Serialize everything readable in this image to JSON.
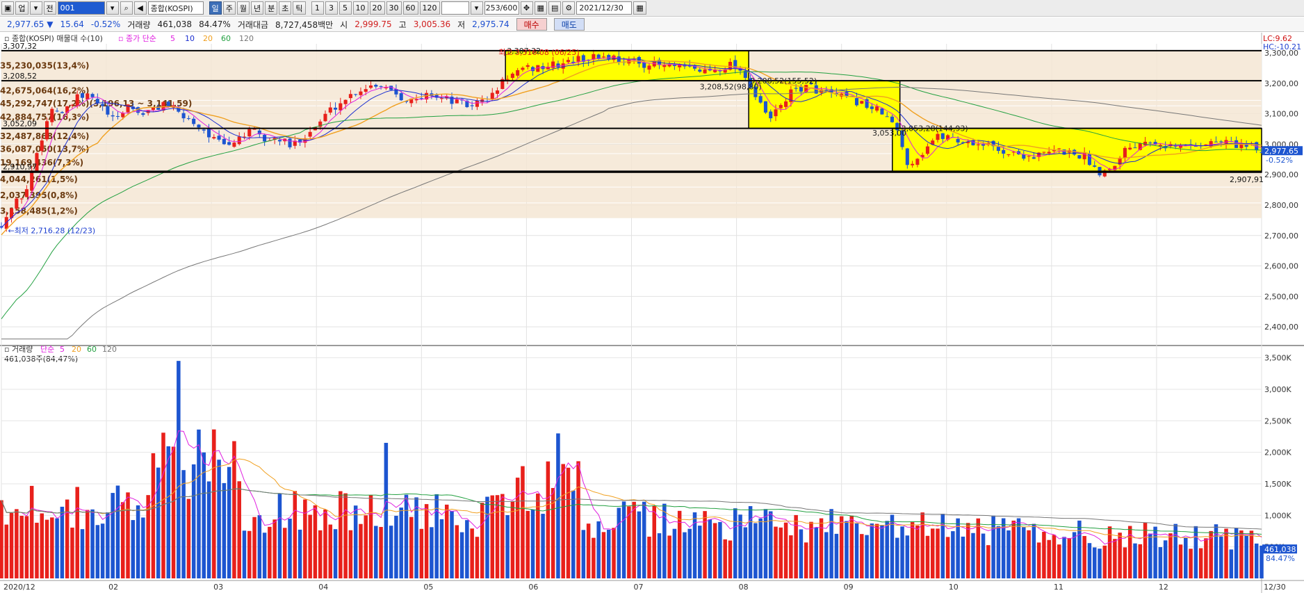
{
  "toolbar": {
    "market_label": "업",
    "type_label": "전",
    "code_value": "001",
    "name_value": "종합(KOSPI)",
    "period_tabs": [
      "일",
      "주",
      "월",
      "년",
      "분",
      "초",
      "틱"
    ],
    "active_period": "일",
    "intervals": [
      "1",
      "3",
      "5",
      "10",
      "20",
      "30",
      "60",
      "120"
    ],
    "count_value": "253/600",
    "date_value": "2021/12/30"
  },
  "quote": {
    "price": "2,977.65",
    "change_arrow": "▼",
    "change": "15.64",
    "change_pct": "-0.52%",
    "volume_label": "거래량",
    "volume": "461,038",
    "volume_ratio": "84.47%",
    "amount_label": "거래대금",
    "amount": "8,727,458백만",
    "open_label": "시",
    "open": "2,999.75",
    "high_label": "고",
    "high": "3,005.36",
    "low_label": "저",
    "low": "2,975.74",
    "buy_label": "매수",
    "sell_label": "매도"
  },
  "colors": {
    "up": "#e8201b",
    "down": "#1d55d0",
    "ma5": "#e020e0",
    "ma10": "#1c2fd0",
    "ma20": "#f0a020",
    "ma60": "#22a040",
    "ma120": "#777777",
    "box": "#ffff00",
    "band": "#f5e6d3"
  },
  "chart_data": [
    {
      "type": "candlestick",
      "title": "종합(KOSPI) 매물대 수(10)",
      "ma_legend_prefix": "종가 단순",
      "ma_periods": [
        "5",
        "10",
        "20",
        "60",
        "120"
      ],
      "corner_labels": {
        "lc": "LC:9.62",
        "hc": "HC:-10.21"
      },
      "ylim": [
        2350,
        3330
      ],
      "y_ticks": [
        "3,300,00",
        "3,200,00",
        "3,100,00",
        "3,000,00",
        "2,900,00",
        "2,800,00",
        "2,700,00",
        "2,600,00",
        "2,500,00",
        "2,400,00"
      ],
      "y_tick_values": [
        3300,
        3200,
        3100,
        3000,
        2900,
        2800,
        2700,
        2600,
        2500,
        2400
      ],
      "x_ticks": [
        "2020/12",
        "02",
        "03",
        "04",
        "05",
        "06",
        "07",
        "08",
        "09",
        "10",
        "11",
        "12",
        "12/30"
      ],
      "current_price_label": "2,977.65",
      "current_change_label": "-0.52%",
      "extremes": {
        "high": "최고 3,316.08 (06/25)",
        "low": "최저 2,716.28 (12/23)"
      },
      "horizontal_lines": [
        {
          "value": 3307.32,
          "label": "3,307,32"
        },
        {
          "value": 3208.52,
          "label": "3,208,52"
        },
        {
          "value": 3052.09,
          "label": "3,052,09"
        },
        {
          "value": 2910.97,
          "label": "2,910,97"
        },
        {
          "value": 2907.91,
          "label": "2,907,91"
        }
      ],
      "volume_profile": [
        {
          "range": [
            3208.52,
            3307.32
          ],
          "label": "35,230,035(13,4%)"
        },
        {
          "range": [
            3143,
            3208.52
          ],
          "label": "42,675,064(16,2%)"
        },
        {
          "range": [
            3125,
            3143
          ],
          "label": "45,292,747(17,2%)(3,196,13 ~ 3,141,59)"
        },
        {
          "range": [
            3052.09,
            3125
          ],
          "label": "42,884,757(16,3%)"
        },
        {
          "range": [
            3000,
            3052.09
          ],
          "label": "32,487,868(12,4%)"
        },
        {
          "range": [
            2968,
            3000
          ],
          "label": "36,087,050(13,7%)"
        },
        {
          "range": [
            2910.97,
            2968
          ],
          "label": "19,169,436(7,3%)"
        },
        {
          "range": [
            2858,
            2910.97
          ],
          "label": "4,044,261(1,5%)"
        },
        {
          "range": [
            2806,
            2858
          ],
          "label": "2,037,395(0,8%)"
        },
        {
          "range": [
            2755,
            2806
          ],
          "label": "3,158,485(1,2%)"
        }
      ],
      "boxes": [
        {
          "from": 0.4,
          "to": 0.593,
          "low": 3208.52,
          "high": 3307.32
        },
        {
          "from": 0.593,
          "to": 0.713,
          "low": 3052.09,
          "high": 3208.52
        },
        {
          "from": 0.707,
          "to": 1.0,
          "low": 2907.91,
          "high": 3052.09
        }
      ],
      "annotations": [
        {
          "x": 0.593,
          "y": 3208.52,
          "label": "3,208,52(155,52)"
        },
        {
          "x": 0.553,
          "y": 3190,
          "label": "3,208,52(98,80)"
        },
        {
          "x": 0.713,
          "y": 3052.09,
          "label": "3,053,28(144,93)"
        },
        {
          "x": 0.69,
          "y": 3038,
          "label": "3,053,00"
        },
        {
          "x": 0.4,
          "y": 3307.32,
          "label": "3,307,32"
        }
      ],
      "close_path": [
        [
          0,
          2740
        ],
        [
          0.01,
          2800
        ],
        [
          0.02,
          2850
        ],
        [
          0.03,
          3000
        ],
        [
          0.04,
          3120
        ],
        [
          0.05,
          3100
        ],
        [
          0.06,
          3150
        ],
        [
          0.07,
          3160
        ],
        [
          0.08,
          3120
        ],
        [
          0.09,
          3070
        ],
        [
          0.1,
          3130
        ],
        [
          0.11,
          3100
        ],
        [
          0.12,
          3110
        ],
        [
          0.13,
          3140
        ],
        [
          0.14,
          3100
        ],
        [
          0.15,
          3080
        ],
        [
          0.16,
          3050
        ],
        [
          0.17,
          3010
        ],
        [
          0.18,
          2990
        ],
        [
          0.19,
          3030
        ],
        [
          0.2,
          3040
        ],
        [
          0.21,
          3010
        ],
        [
          0.22,
          3020
        ],
        [
          0.23,
          2990
        ],
        [
          0.24,
          3030
        ],
        [
          0.25,
          3060
        ],
        [
          0.26,
          3110
        ],
        [
          0.27,
          3140
        ],
        [
          0.28,
          3170
        ],
        [
          0.29,
          3190
        ],
        [
          0.3,
          3200
        ],
        [
          0.31,
          3180
        ],
        [
          0.32,
          3150
        ],
        [
          0.33,
          3140
        ],
        [
          0.34,
          3170
        ],
        [
          0.35,
          3150
        ],
        [
          0.36,
          3140
        ],
        [
          0.37,
          3125
        ],
        [
          0.38,
          3140
        ],
        [
          0.39,
          3160
        ],
        [
          0.4,
          3220
        ],
        [
          0.42,
          3250
        ],
        [
          0.44,
          3260
        ],
        [
          0.46,
          3280
        ],
        [
          0.48,
          3290
        ],
        [
          0.5,
          3270
        ],
        [
          0.52,
          3260
        ],
        [
          0.54,
          3250
        ],
        [
          0.56,
          3240
        ],
        [
          0.58,
          3265
        ],
        [
          0.59,
          3230
        ],
        [
          0.6,
          3140
        ],
        [
          0.61,
          3080
        ],
        [
          0.62,
          3140
        ],
        [
          0.63,
          3180
        ],
        [
          0.64,
          3190
        ],
        [
          0.66,
          3160
        ],
        [
          0.68,
          3140
        ],
        [
          0.7,
          3100
        ],
        [
          0.71,
          3050
        ],
        [
          0.72,
          2930
        ],
        [
          0.73,
          2970
        ],
        [
          0.74,
          3020
        ],
        [
          0.75,
          3030
        ],
        [
          0.76,
          3010
        ],
        [
          0.78,
          3000
        ],
        [
          0.8,
          2970
        ],
        [
          0.82,
          2960
        ],
        [
          0.84,
          2980
        ],
        [
          0.86,
          2960
        ],
        [
          0.87,
          2910
        ],
        [
          0.88,
          2920
        ],
        [
          0.89,
          2980
        ],
        [
          0.91,
          3020
        ],
        [
          0.93,
          2990
        ],
        [
          0.95,
          3000
        ],
        [
          0.97,
          3010
        ],
        [
          0.985,
          2995
        ],
        [
          1.0,
          2977.65
        ]
      ]
    },
    {
      "type": "bar",
      "title": "거래량",
      "ma_legend_prefix": "단순",
      "ma_periods": [
        "5",
        "20",
        "60",
        "120"
      ],
      "summary": "461,038주(84,47%)",
      "ylim": [
        0,
        3650
      ],
      "y_ticks": [
        "3,500K",
        "3,000K",
        "2,500K",
        "2,000K",
        "1,500K",
        "1,000K",
        "500K"
      ],
      "y_tick_values": [
        3500,
        3000,
        2500,
        2000,
        1500,
        1000,
        500
      ],
      "current_label": "461,038",
      "current_pct_label": "84.47%"
    }
  ]
}
